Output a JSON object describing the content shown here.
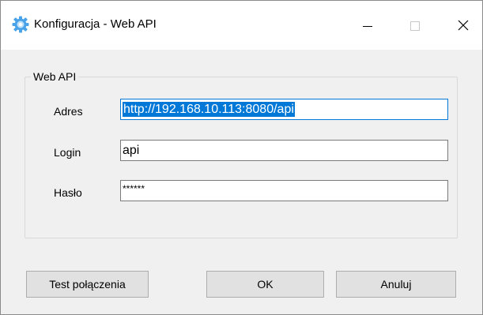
{
  "window": {
    "title": "Konfiguracja - Web API",
    "icon": "gear-icon",
    "accent_color": "#0078d7"
  },
  "group": {
    "caption": "Web API"
  },
  "fields": {
    "address": {
      "label": "Adres",
      "value": "http://192.168.10.113:8080/api"
    },
    "login": {
      "label": "Login",
      "value": "api"
    },
    "password": {
      "label": "Hasło",
      "value": "******"
    }
  },
  "buttons": {
    "test": "Test połączenia",
    "ok": "OK",
    "cancel": "Anuluj"
  }
}
